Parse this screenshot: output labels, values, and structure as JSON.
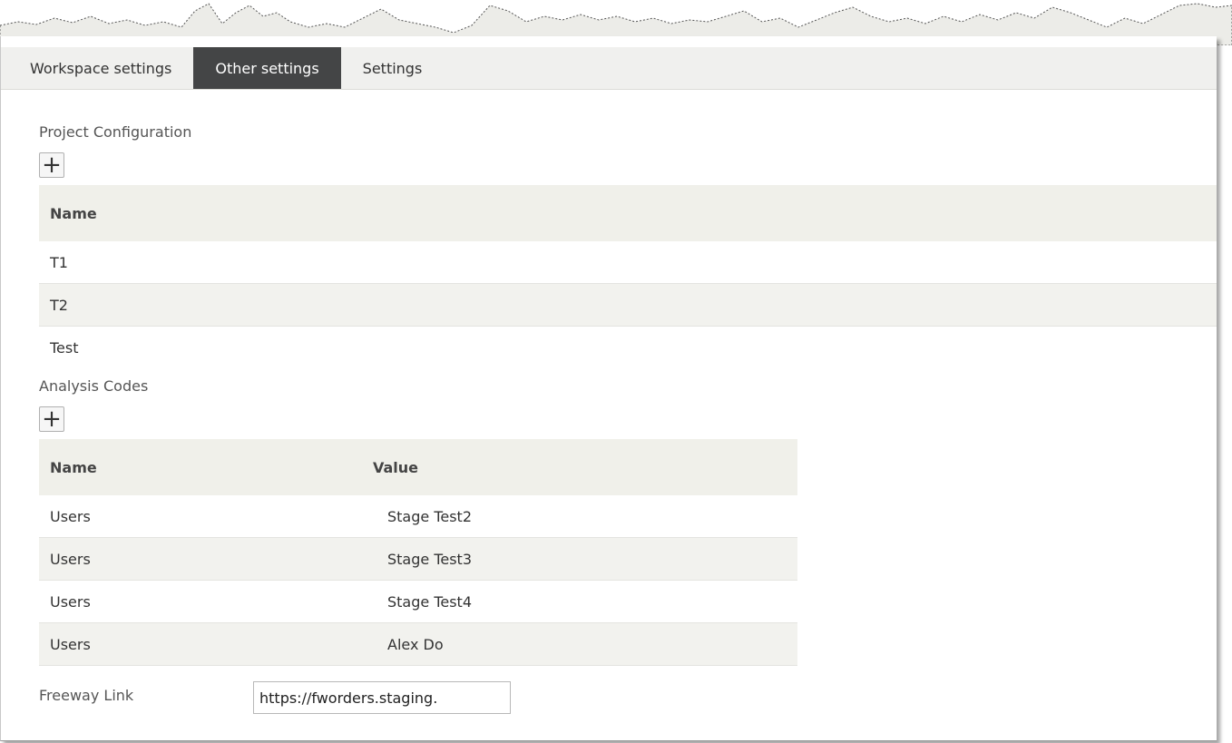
{
  "tabs": [
    {
      "label": "Workspace settings",
      "active": false
    },
    {
      "label": "Other settings",
      "active": true
    },
    {
      "label": "Settings",
      "active": false
    }
  ],
  "project_configuration": {
    "title": "Project Configuration",
    "add_icon": "plus-icon",
    "columns": [
      "Name"
    ],
    "rows": [
      [
        "T1"
      ],
      [
        "T2"
      ],
      [
        "Test"
      ]
    ]
  },
  "analysis_codes": {
    "title": "Analysis Codes",
    "add_icon": "plus-icon",
    "columns": [
      "Name",
      "Value"
    ],
    "rows": [
      [
        "Users",
        "Stage Test2"
      ],
      [
        "Users",
        "Stage Test3"
      ],
      [
        "Users",
        "Stage Test4"
      ],
      [
        "Users",
        "Alex Do"
      ]
    ]
  },
  "freeway_link": {
    "label": "Freeway Link",
    "value": "https://fworders.staging."
  },
  "colors": {
    "active_tab": "#444546",
    "tabbar": "#f0f0ee",
    "header_row": "#f0f0ea"
  }
}
